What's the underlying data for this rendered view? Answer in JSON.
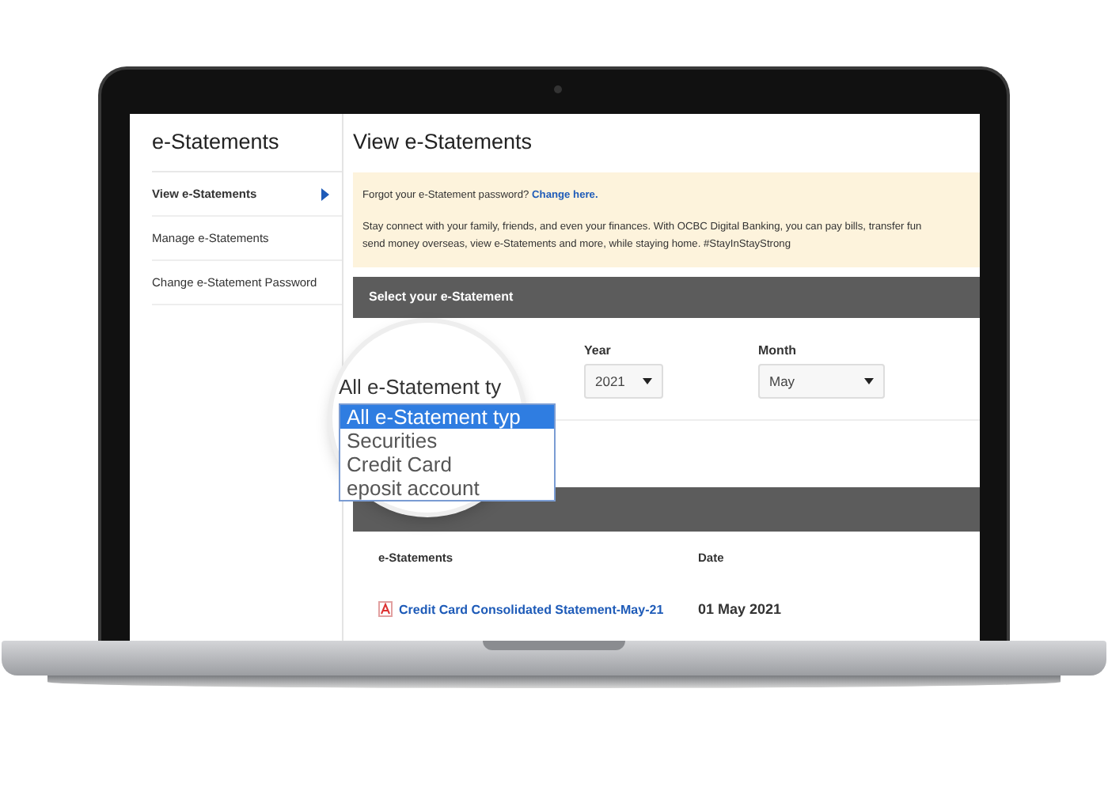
{
  "sidebar": {
    "title": "e-Statements",
    "items": [
      {
        "label": "View e-Statements",
        "selected": true
      },
      {
        "label": "Manage e-Statements",
        "selected": false
      },
      {
        "label": "Change e-Statement Password",
        "selected": false
      }
    ]
  },
  "page_title": "View e-Statements",
  "notice": {
    "prompt": "Forgot your e-Statement password?",
    "link": "Change here.",
    "lines": [
      "Stay connect with your family, friends, and even your finances. With OCBC Digital Banking, you can pay bills, transfer fun",
      "send money overseas, view e-Statements and more, while staying home. #StayInStayStrong"
    ]
  },
  "form": {
    "title": "Select your e-Statement",
    "type_select": {
      "value": "All e-Statement ty",
      "options": [
        {
          "label": "All e-Statement typ",
          "selected": true
        },
        {
          "label": "Securities",
          "selected": false
        },
        {
          "label": "Credit Card",
          "selected": false
        },
        {
          "label": "eposit account",
          "selected": false
        }
      ]
    },
    "year": {
      "label": "Year",
      "value": "2021"
    },
    "month": {
      "label": "Month",
      "value": "May"
    }
  },
  "table": {
    "columns": [
      "e-Statements",
      "Date"
    ],
    "rows": [
      {
        "name": "Credit Card Consolidated Statement-May-21",
        "date": "01 May 2021"
      }
    ]
  }
}
